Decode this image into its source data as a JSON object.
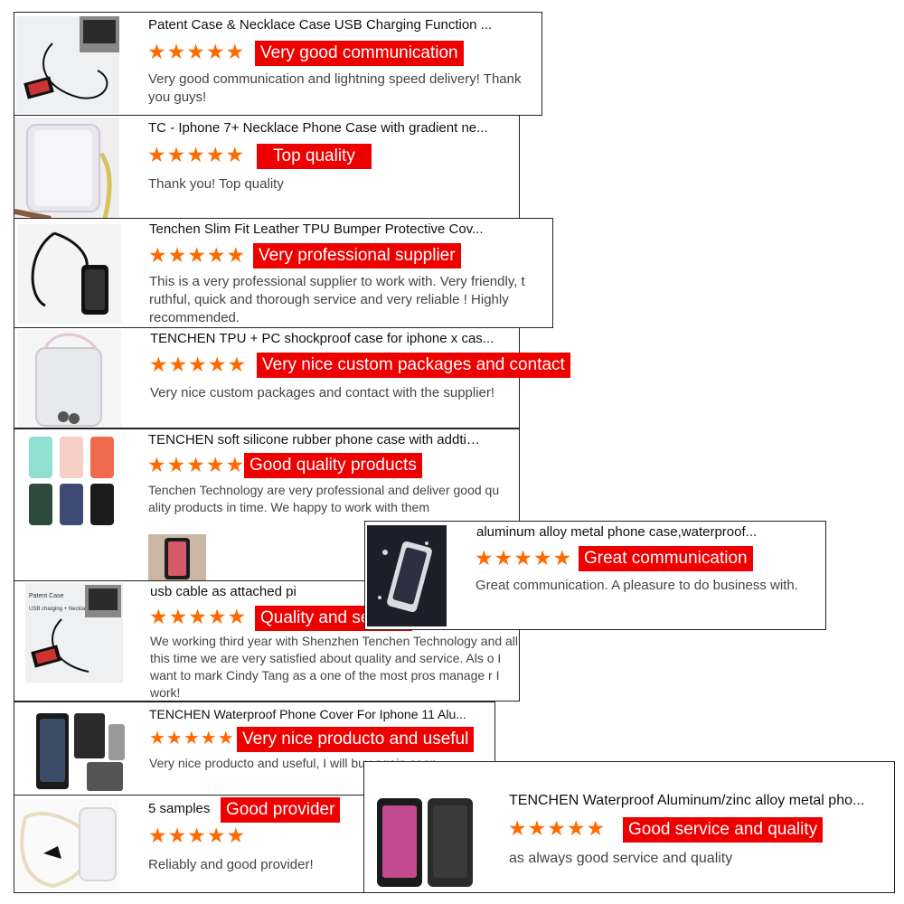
{
  "reviews": [
    {
      "title": "Patent Case & Necklace Case USB Charging Function ...",
      "stars": "★★★★★",
      "tag": "Very good communication",
      "text": "Very good communication and lightning speed delivery! Thank you guys!"
    },
    {
      "title": "TC - Iphone 7+ Necklace Phone Case with gradient ne...",
      "stars": "★★★★★",
      "tag": "Top quality",
      "text": "Thank you! Top quality"
    },
    {
      "title": "Tenchen Slim Fit Leather TPU Bumper Protective Cov...",
      "stars": "★★★★★",
      "tag": "Very professional supplier",
      "text": "This is a very professional supplier to work with. Very friendly, t ruthful, quick and thorough service and very reliable ! Highly recommended."
    },
    {
      "title": "TENCHEN TPU + PC shockproof case for iphone x cas...",
      "stars": "★★★★★",
      "tag": "Very nice custom packages and contact",
      "text": "Very nice custom packages and contact with the supplier!"
    },
    {
      "title": "TENCHEN soft silicone rubber phone case with addtiv...",
      "stars": "★★★★★",
      "tag": "Good quality products",
      "text": "Tenchen Technology are very professional and deliver good qu ality products in time. We happy to work with them"
    },
    {
      "title": "aluminum alloy metal phone case,waterproof...",
      "stars": "★★★★★",
      "tag": "Great communication",
      "text": "Great communication. A pleasure to do business with."
    },
    {
      "title": "usb cable as attached pi",
      "stars": "★★★★★",
      "tag": "Quality and service",
      "text": "We working third year with Shenzhen Tenchen Technology and all this time we are very satisfied about quality and service. Als o I want to mark Cindy Tang as a one of the most pros manage r I work!",
      "thumb_label_1": "Patent Case",
      "thumb_label_2": "USB charging + Necklace"
    },
    {
      "title": "TENCHEN Waterproof Phone Cover For Iphone 11 Alu...",
      "stars": "★★★★★",
      "tag": "Very nice producto and useful",
      "text": "Very nice producto and useful, I will buy again soon."
    },
    {
      "title": "5 samples",
      "stars": "★★★★★",
      "tag": "Good provider",
      "text": "Reliably and good provider!"
    },
    {
      "title": "TENCHEN Waterproof Aluminum/zinc alloy metal pho...",
      "stars": "★★★★★",
      "tag": "Good service and quality",
      "text": "as always good service and quality"
    }
  ],
  "colors": {
    "star": "#ff6a00",
    "tag_bg": "#ee0000",
    "tag_text": "#ffffff",
    "border": "#222222"
  }
}
